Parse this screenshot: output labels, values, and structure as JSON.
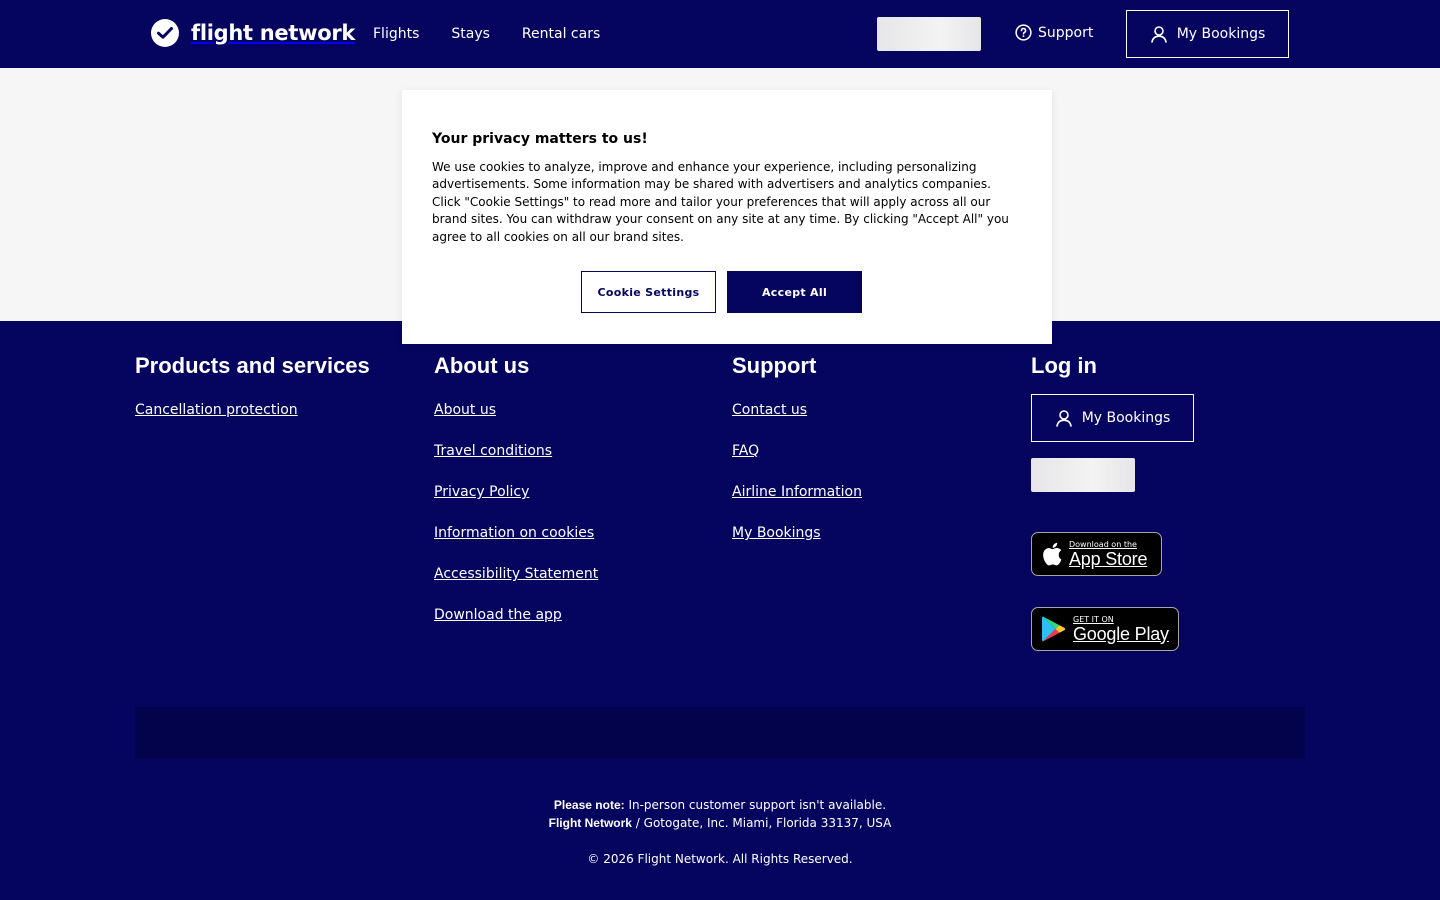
{
  "header": {
    "logo_text": "flight network",
    "nav": [
      "Flights",
      "Stays",
      "Rental cars"
    ],
    "support_label": "Support",
    "my_bookings_label": "My Bookings"
  },
  "cookie_modal": {
    "title": "Your privacy matters to us!",
    "body": "We use cookies to analyze, improve and enhance your experience, including personalizing advertisements. Some information may be shared with advertisers and analytics companies. Click \"Cookie Settings\" to read more and tailor your preferences that will apply across all our brand sites. You can withdraw your consent on any site at any time. By clicking \"Accept All\" you agree to all cookies on all our brand sites.",
    "settings_label": "Cookie Settings",
    "accept_label": "Accept All"
  },
  "footer": {
    "products": {
      "title": "Products and services",
      "links": [
        "Cancellation protection"
      ]
    },
    "about": {
      "title": "About us",
      "links": [
        "About us",
        "Travel conditions",
        "Privacy Policy",
        "Information on cookies",
        "Accessibility Statement",
        "Download the app"
      ]
    },
    "support": {
      "title": "Support",
      "links": [
        "Contact us",
        "FAQ",
        "Airline Information",
        "My Bookings"
      ]
    },
    "login": {
      "title": "Log in",
      "my_bookings_label": "My Bookings",
      "app_store_small": "Download on the",
      "app_store_big": "App Store",
      "google_play_small": "GET IT ON",
      "google_play_big": "Google Play"
    },
    "note_label": "Please note:",
    "note_text": " In-person customer support isn't available.",
    "company_bold": "Flight Network",
    "company_text": " / Gotogate, Inc. Miami, Florida 33137, USA",
    "copyright": "© 2026 Flight Network. All Rights Reserved."
  },
  "colors": {
    "brand_navy": "#05055f",
    "band_light": "#f6f6f6",
    "strip_dark": "#03034b"
  }
}
